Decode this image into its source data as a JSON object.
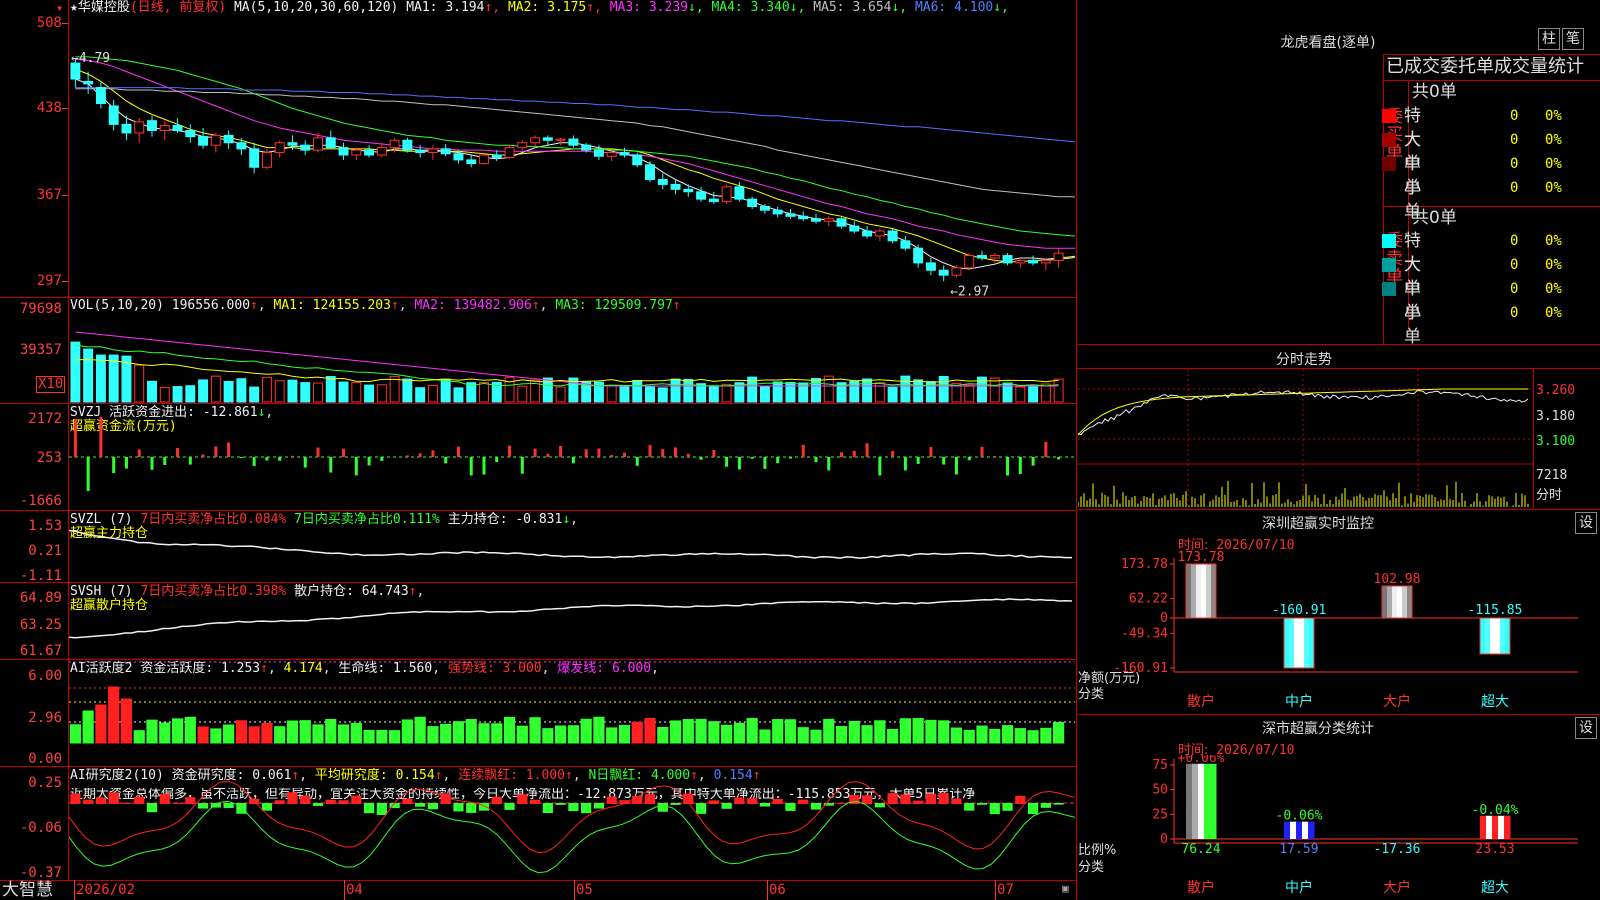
{
  "stock": {
    "name": "华媒控股",
    "period": "(日线, 前复权)",
    "ma_label": "MA(5,10,20,30,60,120)",
    "ma": [
      {
        "label": "MA1:",
        "value": "3.194",
        "arrow": "↑",
        "color": "#f0f0f0"
      },
      {
        "label": "MA2:",
        "value": "3.175",
        "arrow": "↑",
        "color": "#ffff00"
      },
      {
        "label": "MA3:",
        "value": "3.239",
        "arrow": "↓",
        "color": "#ff30ff"
      },
      {
        "label": "MA4:",
        "value": "3.340",
        "arrow": "↓",
        "color": "#30ff30"
      },
      {
        "label": "MA5:",
        "value": "3.654",
        "arrow": "↓",
        "color": "#c0c0c0"
      },
      {
        "label": "MA6:",
        "value": "4.100",
        "arrow": "↓",
        "color": "#5080ff"
      }
    ],
    "y_axis": [
      "508",
      "438",
      "367",
      "297"
    ],
    "high_mark": "4.79",
    "low_mark": "2.97",
    "candles": [
      {
        "o": 4.75,
        "h": 4.79,
        "l": 4.55,
        "c": 4.62
      },
      {
        "o": 4.6,
        "h": 4.68,
        "l": 4.5,
        "c": 4.58
      },
      {
        "o": 4.55,
        "h": 4.6,
        "l": 4.38,
        "c": 4.42
      },
      {
        "o": 4.4,
        "h": 4.45,
        "l": 4.2,
        "c": 4.25
      },
      {
        "o": 4.25,
        "h": 4.32,
        "l": 4.12,
        "c": 4.18
      },
      {
        "o": 4.18,
        "h": 4.3,
        "l": 4.1,
        "c": 4.27
      },
      {
        "o": 4.28,
        "h": 4.32,
        "l": 4.15,
        "c": 4.2
      },
      {
        "o": 4.2,
        "h": 4.28,
        "l": 4.12,
        "c": 4.24
      },
      {
        "o": 4.24,
        "h": 4.3,
        "l": 4.18,
        "c": 4.2
      },
      {
        "o": 4.2,
        "h": 4.25,
        "l": 4.1,
        "c": 4.15
      },
      {
        "o": 4.15,
        "h": 4.22,
        "l": 4.05,
        "c": 4.08
      },
      {
        "o": 4.08,
        "h": 4.18,
        "l": 4.02,
        "c": 4.16
      },
      {
        "o": 4.16,
        "h": 4.2,
        "l": 4.05,
        "c": 4.1
      },
      {
        "o": 4.1,
        "h": 4.14,
        "l": 4.0,
        "c": 4.05
      },
      {
        "o": 4.05,
        "h": 4.1,
        "l": 3.85,
        "c": 3.9
      },
      {
        "o": 3.9,
        "h": 4.05,
        "l": 3.88,
        "c": 4.02
      },
      {
        "o": 4.02,
        "h": 4.12,
        "l": 3.98,
        "c": 4.1
      },
      {
        "o": 4.1,
        "h": 4.16,
        "l": 4.04,
        "c": 4.08
      },
      {
        "o": 4.08,
        "h": 4.12,
        "l": 4.0,
        "c": 4.04
      },
      {
        "o": 4.04,
        "h": 4.18,
        "l": 4.02,
        "c": 4.14
      },
      {
        "o": 4.14,
        "h": 4.2,
        "l": 4.05,
        "c": 4.06
      },
      {
        "o": 4.06,
        "h": 4.1,
        "l": 3.96,
        "c": 4.0
      },
      {
        "o": 4.0,
        "h": 4.06,
        "l": 3.96,
        "c": 4.04
      },
      {
        "o": 4.04,
        "h": 4.08,
        "l": 3.98,
        "c": 4.0
      },
      {
        "o": 4.0,
        "h": 4.1,
        "l": 3.98,
        "c": 4.06
      },
      {
        "o": 4.06,
        "h": 4.14,
        "l": 4.02,
        "c": 4.12
      },
      {
        "o": 4.12,
        "h": 4.14,
        "l": 4.02,
        "c": 4.04
      },
      {
        "o": 4.04,
        "h": 4.08,
        "l": 3.98,
        "c": 4.02
      },
      {
        "o": 4.02,
        "h": 4.08,
        "l": 3.96,
        "c": 4.05
      },
      {
        "o": 4.05,
        "h": 4.09,
        "l": 3.99,
        "c": 4.01
      },
      {
        "o": 4.01,
        "h": 4.04,
        "l": 3.93,
        "c": 3.96
      },
      {
        "o": 3.96,
        "h": 4.0,
        "l": 3.9,
        "c": 3.93
      },
      {
        "o": 3.93,
        "h": 4.02,
        "l": 3.92,
        "c": 4.0
      },
      {
        "o": 4.0,
        "h": 4.04,
        "l": 3.95,
        "c": 3.98
      },
      {
        "o": 3.98,
        "h": 4.08,
        "l": 3.97,
        "c": 4.06
      },
      {
        "o": 4.06,
        "h": 4.12,
        "l": 4.04,
        "c": 4.1
      },
      {
        "o": 4.1,
        "h": 4.16,
        "l": 4.06,
        "c": 4.14
      },
      {
        "o": 4.14,
        "h": 4.16,
        "l": 4.08,
        "c": 4.12
      },
      {
        "o": 4.12,
        "h": 4.14,
        "l": 4.08,
        "c": 4.13
      },
      {
        "o": 4.13,
        "h": 4.16,
        "l": 4.06,
        "c": 4.08
      },
      {
        "o": 4.08,
        "h": 4.1,
        "l": 4.02,
        "c": 4.04
      },
      {
        "o": 4.04,
        "h": 4.08,
        "l": 3.96,
        "c": 3.99
      },
      {
        "o": 3.99,
        "h": 4.04,
        "l": 3.95,
        "c": 4.02
      },
      {
        "o": 4.02,
        "h": 4.06,
        "l": 3.98,
        "c": 4.0
      },
      {
        "o": 4.0,
        "h": 4.02,
        "l": 3.9,
        "c": 3.92
      },
      {
        "o": 3.92,
        "h": 3.95,
        "l": 3.78,
        "c": 3.8
      },
      {
        "o": 3.8,
        "h": 3.85,
        "l": 3.72,
        "c": 3.76
      },
      {
        "o": 3.76,
        "h": 3.8,
        "l": 3.68,
        "c": 3.72
      },
      {
        "o": 3.72,
        "h": 3.76,
        "l": 3.66,
        "c": 3.7
      },
      {
        "o": 3.7,
        "h": 3.74,
        "l": 3.62,
        "c": 3.64
      },
      {
        "o": 3.64,
        "h": 3.7,
        "l": 3.6,
        "c": 3.62
      },
      {
        "o": 3.62,
        "h": 3.76,
        "l": 3.6,
        "c": 3.74
      },
      {
        "o": 3.74,
        "h": 3.78,
        "l": 3.62,
        "c": 3.64
      },
      {
        "o": 3.64,
        "h": 3.66,
        "l": 3.56,
        "c": 3.58
      },
      {
        "o": 3.58,
        "h": 3.6,
        "l": 3.52,
        "c": 3.55
      },
      {
        "o": 3.55,
        "h": 3.58,
        "l": 3.49,
        "c": 3.52
      },
      {
        "o": 3.52,
        "h": 3.56,
        "l": 3.48,
        "c": 3.5
      },
      {
        "o": 3.5,
        "h": 3.54,
        "l": 3.46,
        "c": 3.48
      },
      {
        "o": 3.48,
        "h": 3.52,
        "l": 3.44,
        "c": 3.46
      },
      {
        "o": 3.46,
        "h": 3.5,
        "l": 3.42,
        "c": 3.48
      },
      {
        "o": 3.48,
        "h": 3.5,
        "l": 3.4,
        "c": 3.42
      },
      {
        "o": 3.42,
        "h": 3.46,
        "l": 3.36,
        "c": 3.38
      },
      {
        "o": 3.38,
        "h": 3.42,
        "l": 3.32,
        "c": 3.34
      },
      {
        "o": 3.34,
        "h": 3.4,
        "l": 3.3,
        "c": 3.38
      },
      {
        "o": 3.38,
        "h": 3.4,
        "l": 3.28,
        "c": 3.3
      },
      {
        "o": 3.3,
        "h": 3.34,
        "l": 3.22,
        "c": 3.24
      },
      {
        "o": 3.24,
        "h": 3.27,
        "l": 3.08,
        "c": 3.12
      },
      {
        "o": 3.12,
        "h": 3.16,
        "l": 3.02,
        "c": 3.06
      },
      {
        "o": 3.06,
        "h": 3.1,
        "l": 2.97,
        "c": 3.02
      },
      {
        "o": 3.02,
        "h": 3.1,
        "l": 3.0,
        "c": 3.08
      },
      {
        "o": 3.08,
        "h": 3.2,
        "l": 3.06,
        "c": 3.18
      },
      {
        "o": 3.18,
        "h": 3.22,
        "l": 3.14,
        "c": 3.16
      },
      {
        "o": 3.16,
        "h": 3.2,
        "l": 3.12,
        "c": 3.18
      },
      {
        "o": 3.18,
        "h": 3.2,
        "l": 3.1,
        "c": 3.12
      },
      {
        "o": 3.12,
        "h": 3.16,
        "l": 3.08,
        "c": 3.14
      },
      {
        "o": 3.14,
        "h": 3.18,
        "l": 3.1,
        "c": 3.12
      },
      {
        "o": 3.12,
        "h": 3.16,
        "l": 3.06,
        "c": 3.14
      },
      {
        "o": 3.14,
        "h": 3.24,
        "l": 3.08,
        "c": 3.2
      }
    ],
    "ma_lines": {
      "ma1": [
        4.62,
        4.58,
        4.48,
        4.38,
        4.3,
        4.26,
        4.22,
        4.21,
        4.2,
        4.18,
        4.15,
        4.14,
        4.12,
        4.09,
        4.04,
        4.02,
        4.04,
        4.07,
        4.07,
        4.08,
        4.08,
        4.06,
        4.04,
        4.03,
        4.02,
        4.05,
        4.05,
        4.04,
        4.04,
        4.03,
        4.02,
        4.0,
        3.98,
        3.97,
        3.98,
        4.02,
        4.06,
        4.08,
        4.1,
        4.1,
        4.08,
        4.06,
        4.03,
        4.01,
        3.98,
        3.93,
        3.86,
        3.8,
        3.75,
        3.71,
        3.67,
        3.66,
        3.65,
        3.62,
        3.58,
        3.55,
        3.52,
        3.5,
        3.48,
        3.47,
        3.45,
        3.42,
        3.38,
        3.36,
        3.34,
        3.3,
        3.24,
        3.17,
        3.12,
        3.08,
        3.07,
        3.09,
        3.11,
        3.14,
        3.16,
        3.16,
        3.15,
        3.16,
        3.17,
        3.19
      ],
      "ma2": [
        4.7,
        4.66,
        4.6,
        4.52,
        4.44,
        4.38,
        4.33,
        4.29,
        4.25,
        4.21,
        4.18,
        4.16,
        4.14,
        4.12,
        4.09,
        4.06,
        4.06,
        4.06,
        4.05,
        4.05,
        4.05,
        4.05,
        4.05,
        4.05,
        4.04,
        4.04,
        4.03,
        4.03,
        4.03,
        4.03,
        4.03,
        4.02,
        4.01,
        4.0,
        4.0,
        4.01,
        4.02,
        4.03,
        4.04,
        4.05,
        4.05,
        4.05,
        4.05,
        4.04,
        4.03,
        4.0,
        3.96,
        3.92,
        3.88,
        3.85,
        3.81,
        3.78,
        3.75,
        3.72,
        3.68,
        3.64,
        3.61,
        3.58,
        3.55,
        3.52,
        3.5,
        3.47,
        3.44,
        3.42,
        3.4,
        3.37,
        3.34,
        3.3,
        3.26,
        3.22,
        3.18,
        3.16,
        3.14,
        3.13,
        3.13,
        3.14,
        3.14,
        3.15,
        3.16,
        3.18
      ],
      "ma3": [
        4.78,
        4.77,
        4.75,
        4.72,
        4.68,
        4.64,
        4.6,
        4.56,
        4.52,
        4.48,
        4.44,
        4.4,
        4.36,
        4.32,
        4.28,
        4.25,
        4.22,
        4.2,
        4.18,
        4.16,
        4.14,
        4.12,
        4.11,
        4.1,
        4.09,
        4.08,
        4.07,
        4.06,
        4.05,
        4.05,
        4.04,
        4.04,
        4.04,
        4.03,
        4.03,
        4.03,
        4.03,
        4.03,
        4.03,
        4.03,
        4.03,
        4.02,
        4.02,
        4.01,
        4.0,
        3.99,
        3.97,
        3.95,
        3.93,
        3.9,
        3.87,
        3.84,
        3.81,
        3.78,
        3.75,
        3.72,
        3.69,
        3.66,
        3.63,
        3.6,
        3.58,
        3.55,
        3.52,
        3.5,
        3.48,
        3.45,
        3.42,
        3.4,
        3.38,
        3.35,
        3.33,
        3.31,
        3.29,
        3.27,
        3.26,
        3.25,
        3.24,
        3.24,
        3.24,
        3.24
      ],
      "ma4": [
        4.8,
        4.8,
        4.79,
        4.78,
        4.77,
        4.75,
        4.73,
        4.71,
        4.69,
        4.66,
        4.63,
        4.6,
        4.57,
        4.54,
        4.5,
        4.46,
        4.42,
        4.38,
        4.35,
        4.32,
        4.29,
        4.26,
        4.24,
        4.22,
        4.2,
        4.18,
        4.16,
        4.15,
        4.14,
        4.12,
        4.11,
        4.1,
        4.09,
        4.08,
        4.08,
        4.07,
        4.07,
        4.06,
        4.06,
        4.05,
        4.05,
        4.05,
        4.04,
        4.04,
        4.03,
        4.02,
        4.01,
        4.0,
        3.99,
        3.97,
        3.95,
        3.93,
        3.91,
        3.89,
        3.86,
        3.84,
        3.81,
        3.79,
        3.76,
        3.73,
        3.71,
        3.68,
        3.66,
        3.63,
        3.61,
        3.58,
        3.56,
        3.53,
        3.51,
        3.48,
        3.46,
        3.44,
        3.42,
        3.4,
        3.38,
        3.37,
        3.36,
        3.35,
        3.34,
        3.34
      ],
      "ma5": [
        4.54,
        4.54,
        4.54,
        4.54,
        4.53,
        4.53,
        4.53,
        4.52,
        4.52,
        4.52,
        4.51,
        4.51,
        4.51,
        4.5,
        4.5,
        4.49,
        4.49,
        4.48,
        4.48,
        4.47,
        4.47,
        4.46,
        4.46,
        4.45,
        4.44,
        4.44,
        4.43,
        4.42,
        4.41,
        4.41,
        4.4,
        4.39,
        4.38,
        4.37,
        4.36,
        4.35,
        4.34,
        4.33,
        4.32,
        4.31,
        4.3,
        4.29,
        4.28,
        4.27,
        4.26,
        4.24,
        4.23,
        4.21,
        4.19,
        4.17,
        4.15,
        4.13,
        4.11,
        4.09,
        4.07,
        4.04,
        4.02,
        4.0,
        3.98,
        3.96,
        3.94,
        3.92,
        3.9,
        3.88,
        3.86,
        3.84,
        3.82,
        3.8,
        3.78,
        3.76,
        3.74,
        3.72,
        3.71,
        3.7,
        3.69,
        3.68,
        3.67,
        3.66,
        3.66,
        3.65
      ],
      "ma6": [
        4.55,
        4.55,
        4.55,
        4.55,
        4.55,
        4.55,
        4.55,
        4.55,
        4.55,
        4.54,
        4.54,
        4.54,
        4.54,
        4.53,
        4.53,
        4.53,
        4.53,
        4.52,
        4.52,
        4.52,
        4.51,
        4.51,
        4.51,
        4.5,
        4.5,
        4.49,
        4.49,
        4.48,
        4.48,
        4.47,
        4.47,
        4.46,
        4.46,
        4.45,
        4.45,
        4.44,
        4.44,
        4.43,
        4.43,
        4.42,
        4.42,
        4.41,
        4.41,
        4.4,
        4.39,
        4.39,
        4.38,
        4.37,
        4.37,
        4.36,
        4.35,
        4.35,
        4.34,
        4.33,
        4.32,
        4.32,
        4.31,
        4.3,
        4.29,
        4.28,
        4.28,
        4.27,
        4.26,
        4.25,
        4.24,
        4.23,
        4.23,
        4.22,
        4.21,
        4.2,
        4.19,
        4.18,
        4.17,
        4.16,
        4.15,
        4.14,
        4.13,
        4.12,
        4.11,
        4.1
      ]
    }
  },
  "vol": {
    "label": "VOL(5,10,20)",
    "value": "196556.000",
    "ma1": "124155.203",
    "ma2": "139482.906",
    "ma3": "129509.797",
    "y_axis": [
      "79698",
      "39357"
    ],
    "unit": "X10"
  },
  "svzj": {
    "label": "SVZJ",
    "name": "活跃资金进出:",
    "value": "-12.861",
    "sub": "超赢资金流(万元)",
    "y_axis": [
      "2172",
      "253",
      "-1666"
    ]
  },
  "svzl": {
    "label": "SVZL (7)",
    "t1": "7日内买卖净占比0.084%",
    "t2": "7日内买卖净占比0.111%",
    "t3": "主力持仓:",
    "value": "-0.831",
    "sub": "超赢主力持仓",
    "y_axis": [
      "1.53",
      "0.21",
      "-1.11"
    ]
  },
  "svsh": {
    "label": "SVSH (7)",
    "t1": "7日内买卖净占比0.398%",
    "t2": "散户持仓:",
    "value": "64.743",
    "sub": "超赢散户持仓",
    "y_axis": [
      "64.89",
      "63.25",
      "61.67"
    ]
  },
  "ai1": {
    "label": "AI活跃度2",
    "t1": "资金活跃度:",
    "v1": "1.253",
    "v2": "4.174",
    "t3": "生命线:",
    "v3": "1.560",
    "t4": "强势线:",
    "v4": "3.000",
    "t5": "爆发线:",
    "v5": "6.000",
    "y_axis": [
      "6.00",
      "2.96",
      "0.00"
    ]
  },
  "ai2": {
    "label": "AI研究度2(10)",
    "t1": "资金研究度:",
    "v1": "0.061",
    "t2": "平均研究度:",
    "v2": "0.154",
    "t3": "连续飘红:",
    "v3": "1.000",
    "t4": "N日飘红:",
    "v4": "4.000",
    "v5": "0.154",
    "comment": "近期大资金总体偏多，虽不活跃，但有异动，宜关注大资金的持续性，今日大单净流出：-12.873万元，其中特大单净流出：-115.853万元，大单5日累计净",
    "y_axis": [
      "0.25",
      "-0.06",
      "-0.37"
    ]
  },
  "xaxis": {
    "app": "大智慧",
    "labels": [
      "2026/02",
      "04",
      "05",
      "06",
      "07"
    ]
  },
  "lhb": {
    "title": "龙虎看盘(逐单)",
    "btn1": "柱",
    "btn2": "笔",
    "subtitle": "已成交委托单成交量统计",
    "buy_label": "委买单",
    "sell_label": "委卖单",
    "buy_total": "共0单",
    "sell_total": "共0单",
    "buy_rows": [
      {
        "name": "特大",
        "count": "0",
        "pct": "0%",
        "color": "#ff0000"
      },
      {
        "name": "大单",
        "count": "0",
        "pct": "0%",
        "color": "#a00000"
      },
      {
        "name": "中单",
        "count": "0",
        "pct": "0%",
        "color": "#700000"
      },
      {
        "name": "小单",
        "count": "0",
        "pct": "0%",
        "color": ""
      }
    ],
    "sell_rows": [
      {
        "name": "特大",
        "count": "0",
        "pct": "0%",
        "color": "#00ffff"
      },
      {
        "name": "大单",
        "count": "0",
        "pct": "0%",
        "color": "#00a0a0"
      },
      {
        "name": "中单",
        "count": "0",
        "pct": "0%",
        "color": "#008080"
      },
      {
        "name": "小单",
        "count": "0",
        "pct": "0%",
        "color": ""
      }
    ]
  },
  "intraday": {
    "title": "分时走势",
    "y_axis": [
      "3.260",
      "3.180",
      "3.100"
    ],
    "vol": "7218",
    "vol_unit": "分时"
  },
  "sz_monitor": {
    "title": "深圳超赢实时监控",
    "btn": "设",
    "time_label": "时间:",
    "time": "2026/07/10",
    "y_axis": [
      "173.78",
      "62.22",
      "0",
      "-49.34",
      "-160.91"
    ],
    "y_title": "净额(万元)",
    "x_title": "分类",
    "bars": [
      {
        "cat": "散户",
        "value": 173.78,
        "label": "173.78"
      },
      {
        "cat": "中户",
        "value": -160.91,
        "label": "-160.91"
      },
      {
        "cat": "大户",
        "value": 102.98,
        "label": "102.98"
      },
      {
        "cat": "超大",
        "value": -115.85,
        "label": "-115.85"
      }
    ]
  },
  "sz_class": {
    "title": "深市超赢分类统计",
    "btn": "设",
    "time_label": "时间:",
    "time": "2026/07/10",
    "y_axis": [
      "75",
      "50",
      "25",
      "0"
    ],
    "y_title": "比例%",
    "x_title": "分类",
    "bars": [
      {
        "cat": "散户",
        "value": 76.24,
        "top": "+0.06%",
        "bottom": "76.24"
      },
      {
        "cat": "中户",
        "value": 17.59,
        "top": "-0.06%",
        "bottom": "17.59"
      },
      {
        "cat": "大户",
        "value": 0,
        "top": "",
        "bottom": "-17.36"
      },
      {
        "cat": "超大",
        "value": 23.53,
        "top": "-0.04%",
        "bottom": "23.53"
      }
    ]
  },
  "chart_data": [
    {
      "type": "bar",
      "title": "深圳超赢实时监控",
      "ylabel": "净额(万元)",
      "xlabel": "分类",
      "categories": [
        "散户",
        "中户",
        "大户",
        "超大"
      ],
      "values": [
        173.78,
        -160.91,
        102.98,
        -115.85
      ],
      "ylim": [
        -160.91,
        173.78
      ]
    },
    {
      "type": "bar",
      "title": "深市超赢分类统计",
      "ylabel": "比例%",
      "xlabel": "分类",
      "categories": [
        "散户",
        "中户",
        "大户",
        "超大"
      ],
      "values": [
        76.24,
        17.59,
        -17.36,
        23.53
      ],
      "ylim": [
        0,
        75
      ]
    }
  ]
}
